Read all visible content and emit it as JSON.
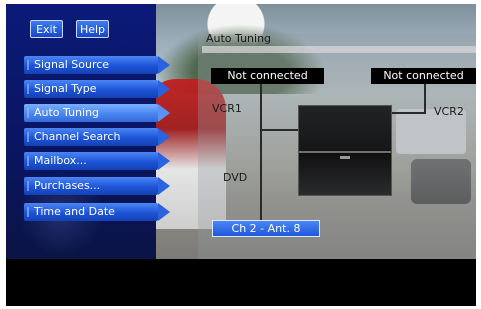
{
  "header": {
    "exit_label": "Exit",
    "help_label": "Help"
  },
  "menu": {
    "items": [
      {
        "label": "Signal Source"
      },
      {
        "label": "Signal Type"
      },
      {
        "label": "Auto Tuning"
      },
      {
        "label": "Channel Search"
      },
      {
        "label": "Mailbox..."
      },
      {
        "label": "Purchases..."
      },
      {
        "label": "Time and Date"
      }
    ],
    "selected": "Auto Tuning"
  },
  "panel": {
    "title": "Auto Tuning",
    "vcr1_status": "Not connected",
    "vcr2_status": "Not connected",
    "vcr1_label": "VCR1",
    "vcr2_label": "VCR2",
    "dvd_label": "DVD",
    "channel": "Ch 2 - Ant. 8"
  },
  "colors": {
    "menu_panel": "#0b1a78",
    "menu_item": "#1d54d8",
    "menu_item_selected": "#4a86f2",
    "status_box": "#000000"
  }
}
